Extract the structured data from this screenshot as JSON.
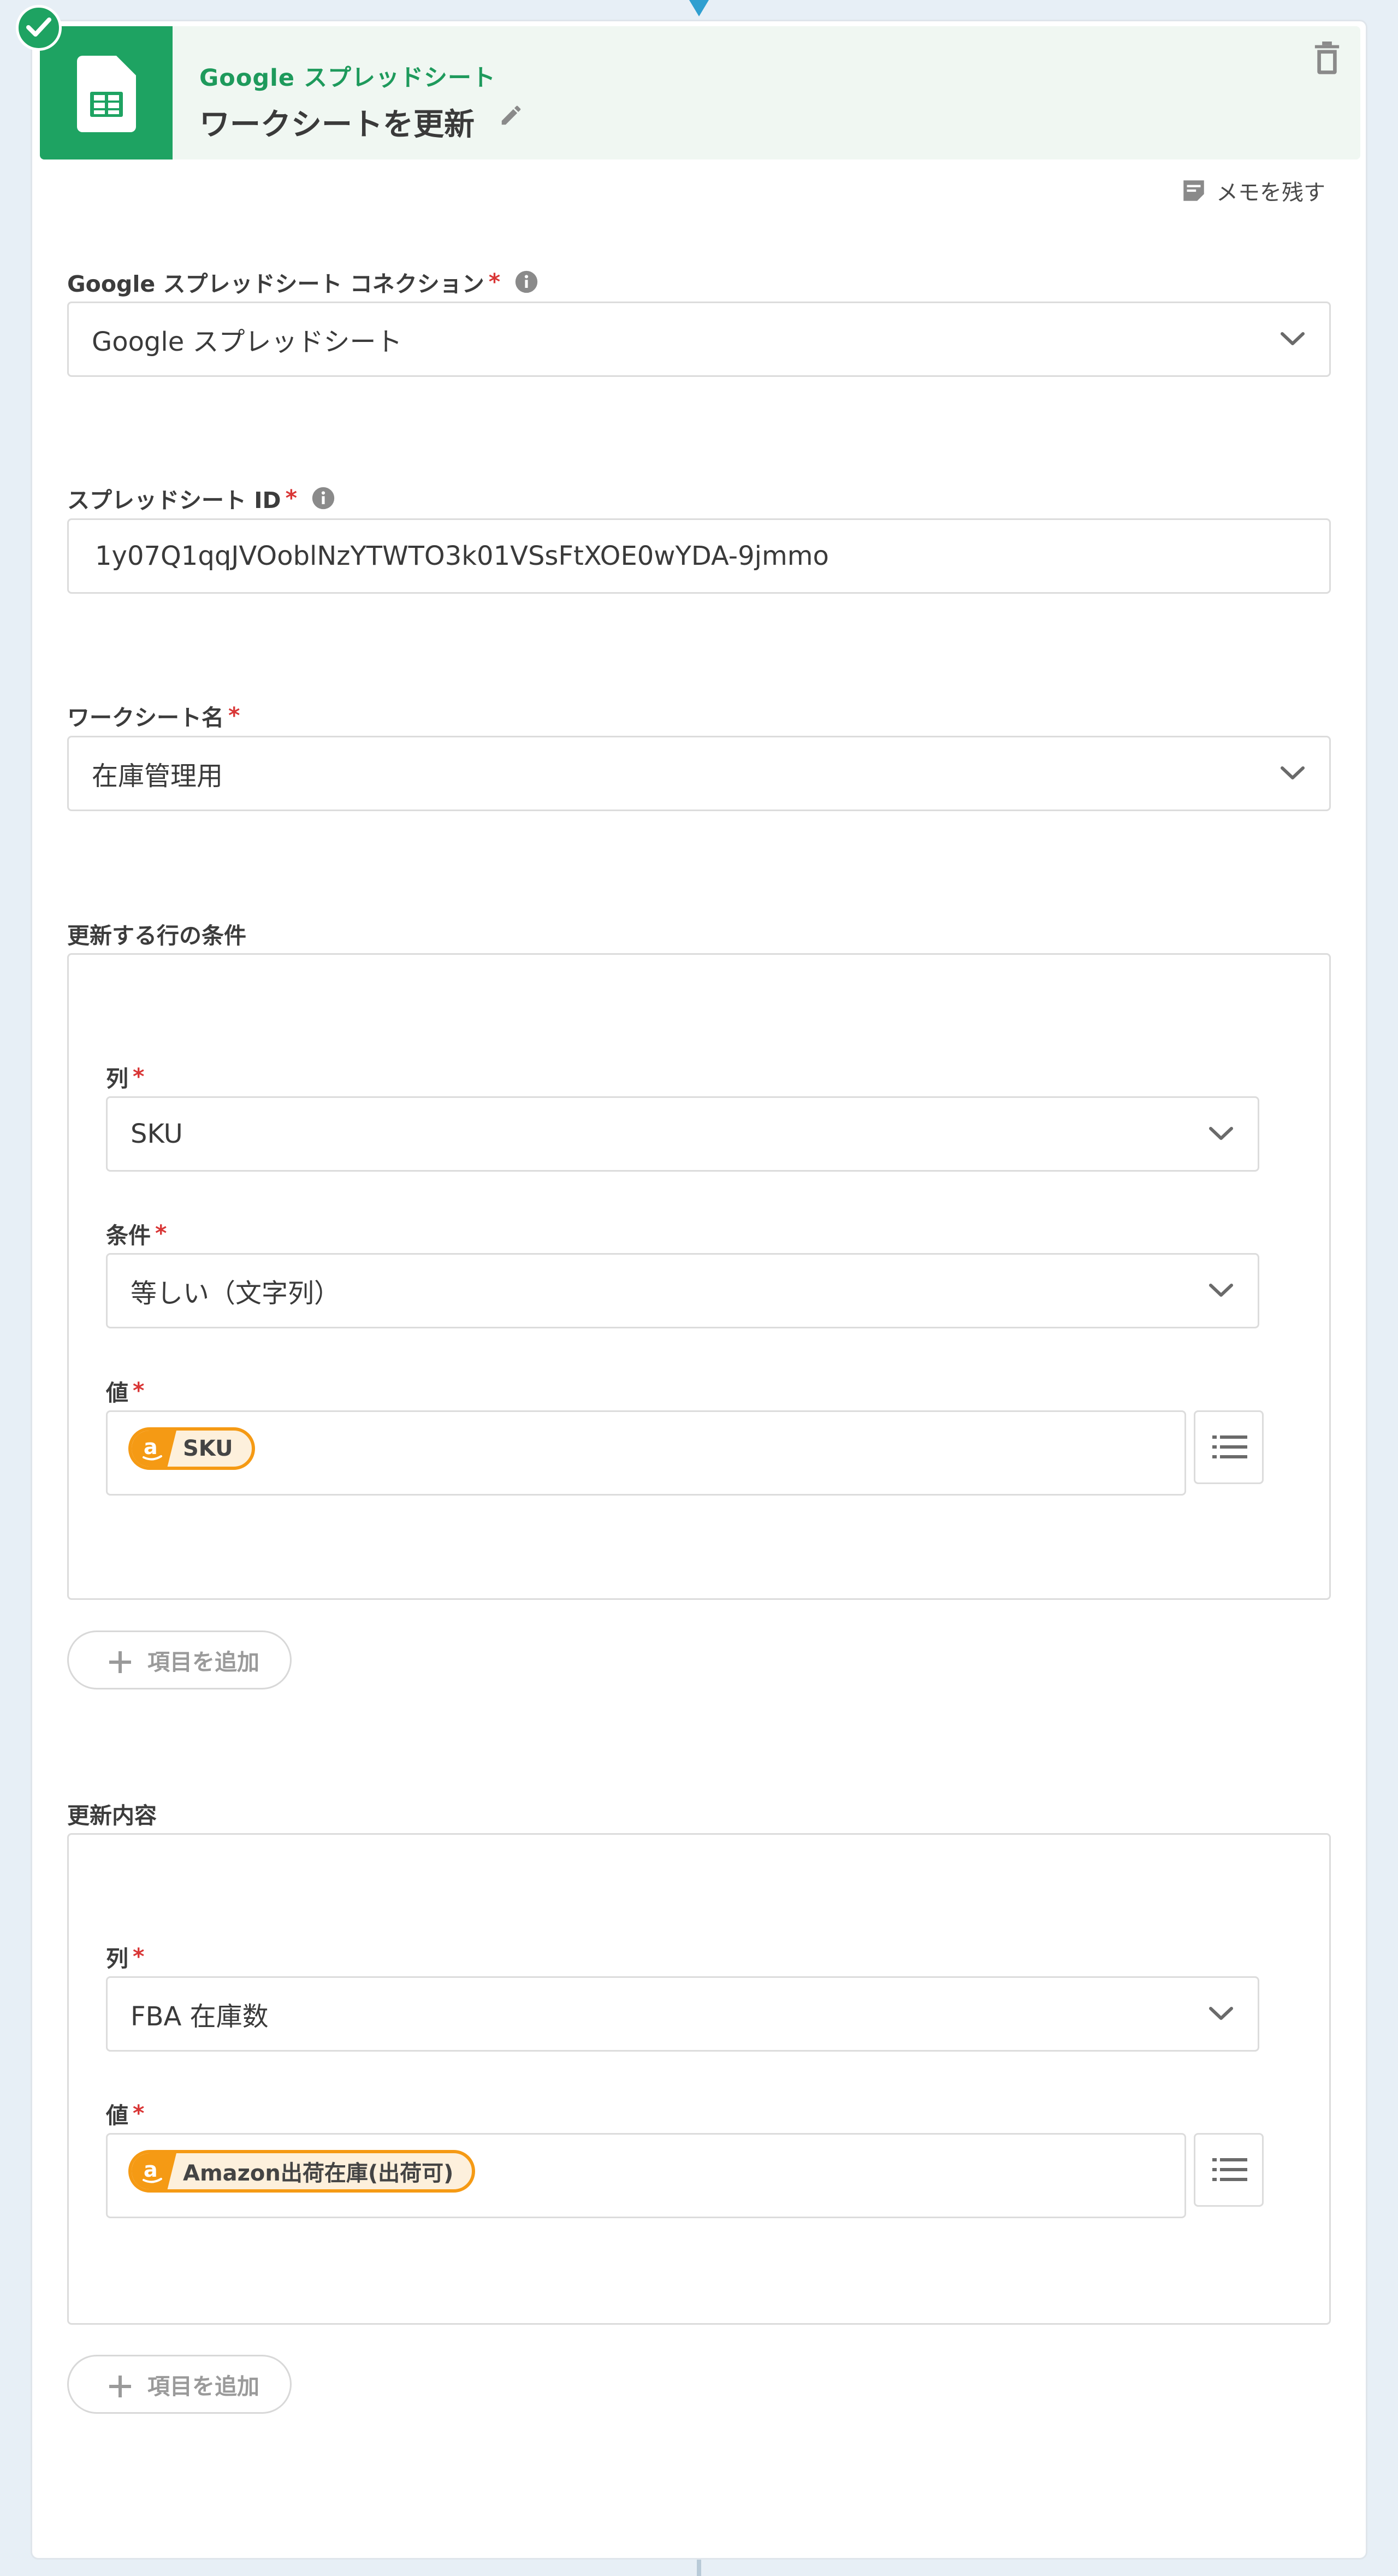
{
  "header": {
    "app_name": "Google スプレッドシート",
    "title": "ワークシートを更新"
  },
  "memo_label": "メモを残す",
  "connection": {
    "label": "Google スプレッドシート コネクション",
    "value": "Google スプレッドシート"
  },
  "spreadsheet_id": {
    "label": "スプレッドシート ID",
    "value": "1y07Q1qqJVOoblNzYTWTO3k01VSsFtXOE0wYDA-9jmmo"
  },
  "worksheet": {
    "label": "ワークシート名",
    "value": "在庫管理用"
  },
  "conditions": {
    "section_label": "更新する行の条件",
    "column_label": "列",
    "column_value": "SKU",
    "condition_label": "条件",
    "condition_value": "等しい（文字列）",
    "value_label": "値",
    "value_chip": "SKU",
    "add_label": "項目を追加"
  },
  "updates": {
    "section_label": "更新内容",
    "column_label": "列",
    "column_value": "FBA 在庫数",
    "value_label": "値",
    "value_chip": "Amazon出荷在庫(出荷可)",
    "add_label": "項目を追加"
  },
  "required_mark": "*",
  "colors": {
    "brand_green": "#1ea362",
    "amazon_orange": "#f59a14",
    "required_red": "#d93636",
    "connector_blue": "#2f9fd0"
  }
}
